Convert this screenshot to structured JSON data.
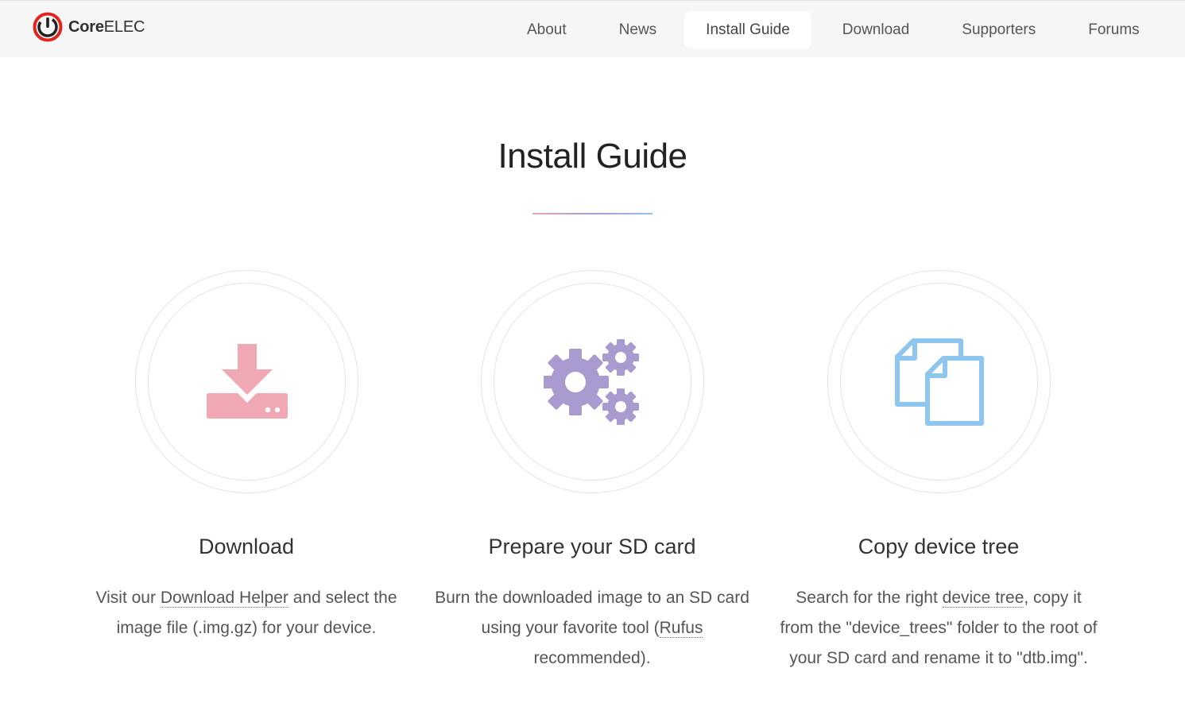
{
  "brand": {
    "name_bold": "Core",
    "name_rest": "ELEC",
    "color": "#e0241f"
  },
  "nav": {
    "items": [
      {
        "label": "About"
      },
      {
        "label": "News"
      },
      {
        "label": "Install Guide",
        "active": true
      },
      {
        "label": "Download"
      },
      {
        "label": "Supporters"
      },
      {
        "label": "Forums"
      }
    ]
  },
  "page": {
    "title": "Install Guide"
  },
  "steps": [
    {
      "icon": "download-icon",
      "color": "#f0a8b4",
      "title": "Download",
      "desc_before": "Visit our ",
      "link": "Download Helper",
      "desc_after": " and select the image file (.img.gz) for your device."
    },
    {
      "icon": "gears-icon",
      "color": "#a99bcf",
      "title": "Prepare your SD card",
      "desc_before": "Burn the downloaded image to an SD card using your favorite tool (",
      "link": "Rufus",
      "desc_after": " recommended)."
    },
    {
      "icon": "copy-files-icon",
      "color": "#8fc6ee",
      "title": "Copy device tree",
      "desc_before": "Search for the right ",
      "link": "device tree",
      "desc_after": ", copy it from the \"device_trees\" folder to the root of your SD card and rename it to \"dtb.img\"."
    }
  ]
}
